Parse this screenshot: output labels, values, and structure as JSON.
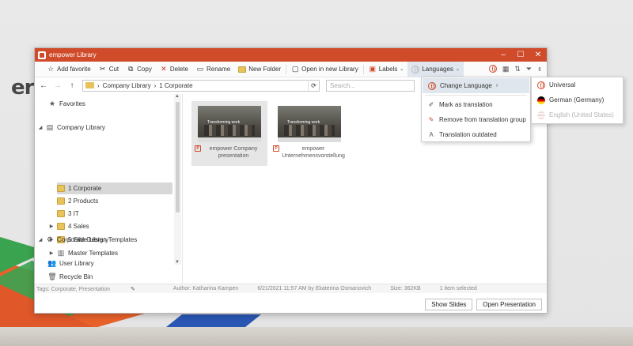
{
  "desktop": {
    "logo_text": "er"
  },
  "window": {
    "title": "empower Library",
    "controls": {
      "minimize": "–",
      "maximize": "☐",
      "close": "✕"
    }
  },
  "toolbar": {
    "add_favorite": "Add favorite",
    "cut": "Cut",
    "copy": "Copy",
    "delete": "Delete",
    "rename": "Rename",
    "new_folder": "New Folder",
    "open_new_library": "Open in new Library",
    "labels": "Labels",
    "languages": "Languages"
  },
  "address": {
    "path": [
      "Company Library",
      "1 Corporate"
    ],
    "separator": "›",
    "search_placeholder": "Search..."
  },
  "tree": {
    "favorites": "Favorites",
    "company_library": "Company Library",
    "folders": [
      "1 Corporate",
      "2 Products",
      "3 IT",
      "4 Sales",
      "5 Slide Library"
    ],
    "user_library": "User Library",
    "corporate_design_templates": "Corporate Design Templates",
    "master_templates": "Master Templates",
    "recycle_bin": "Recycle Bin"
  },
  "files": [
    {
      "name": "empower Company presentation",
      "thumb_caption": "Transforming work"
    },
    {
      "name": "empower Unternehmensvorstellung",
      "thumb_caption": "Transforming work"
    }
  ],
  "status": {
    "tags": "Tags: Corporate, Presentation",
    "author": "Author: Katharina Kampen",
    "modified": "6/21/2021 11:57 AM by Ekaterina Osmanovich",
    "size": "Size: 362KB",
    "selection": "1 item selected"
  },
  "buttons": {
    "show_slides": "Show Slides",
    "open_presentation": "Open Presentation"
  },
  "language_menu": {
    "change_language": "Change Language",
    "mark_translation": "Mark as translation",
    "remove_group": "Remove from translation group",
    "outdated": "Translation outdated"
  },
  "language_submenu": {
    "universal": "Universal",
    "german": "German (Germany)",
    "english": "English (United States)"
  },
  "colors": {
    "accent": "#cf4b2a",
    "folder": "#e8c35a",
    "highlight": "#dfe6ee"
  }
}
